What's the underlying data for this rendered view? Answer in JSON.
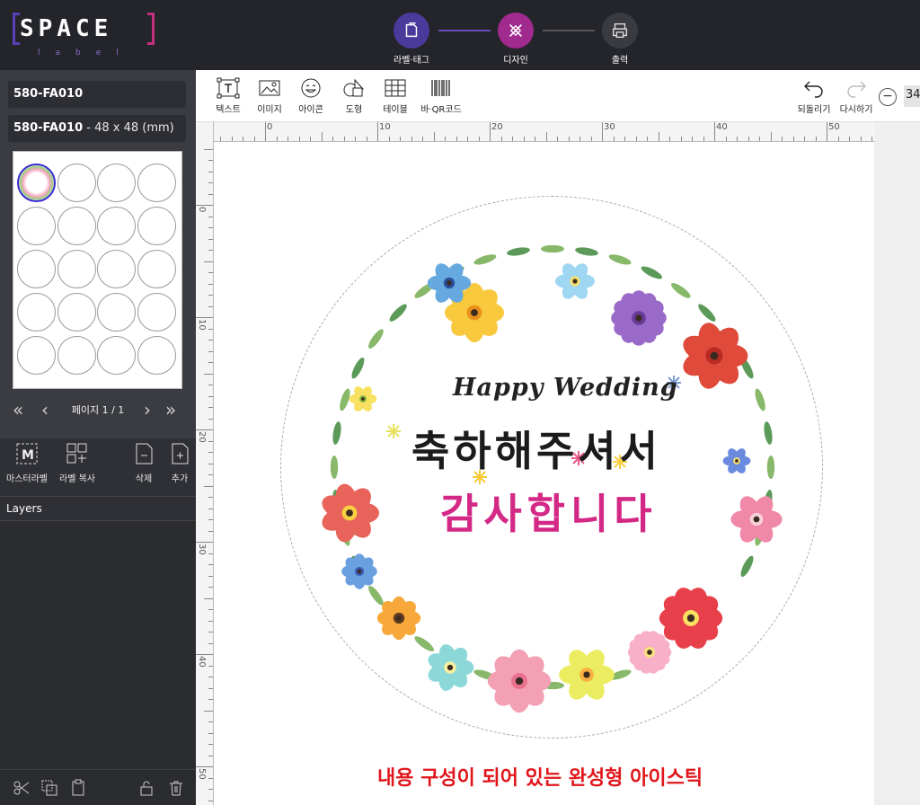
{
  "brand": {
    "name": "SPACE",
    "sub": "label"
  },
  "steps": [
    {
      "label": "라벨·태그",
      "icon": "tag-icon",
      "color": "#4a3a9c"
    },
    {
      "label": "디자인",
      "icon": "design-tools-icon",
      "color": "#a12a8e"
    },
    {
      "label": "출력",
      "icon": "printer-icon",
      "color": "#3a3b40"
    }
  ],
  "sidebar": {
    "product_code": "580-FA010",
    "product_spec_code": "580-FA010",
    "product_spec_size": " - 48 x 48 (mm)",
    "page_text": "페이지 1 / 1",
    "tools": [
      {
        "label": "마스터라벨",
        "icon": "master-label-icon"
      },
      {
        "label": "라벨 복사",
        "icon": "copy-label-icon"
      },
      {
        "label": "삭제",
        "icon": "delete-page-icon"
      },
      {
        "label": "추가",
        "icon": "add-page-icon"
      }
    ],
    "layers_title": "Layers"
  },
  "toolbar": {
    "items": [
      {
        "label": "텍스트",
        "icon": "text-icon"
      },
      {
        "label": "이미지",
        "icon": "image-icon"
      },
      {
        "label": "아이콘",
        "icon": "emoji-icon"
      },
      {
        "label": "도형",
        "icon": "shape-icon"
      },
      {
        "label": "테이블",
        "icon": "table-icon"
      },
      {
        "label": "바·QR코드",
        "icon": "barcode-icon"
      }
    ],
    "undo_label": "되돌리기",
    "redo_label": "다시하기",
    "zoom_value": "34"
  },
  "ruler": {
    "h_ticks": [
      "0",
      "10",
      "20",
      "30",
      "40",
      "50"
    ],
    "v_ticks": [
      "0",
      "10",
      "20",
      "30",
      "40",
      "50"
    ]
  },
  "design": {
    "line1": "Happy Wedding",
    "line2": "축하해주셔서",
    "line3": "감사합니다",
    "line3_color": "#d42886"
  },
  "caption": "내용 구성이 되어 있는 완성형 아이스틱",
  "caption_color": "#e0161b"
}
